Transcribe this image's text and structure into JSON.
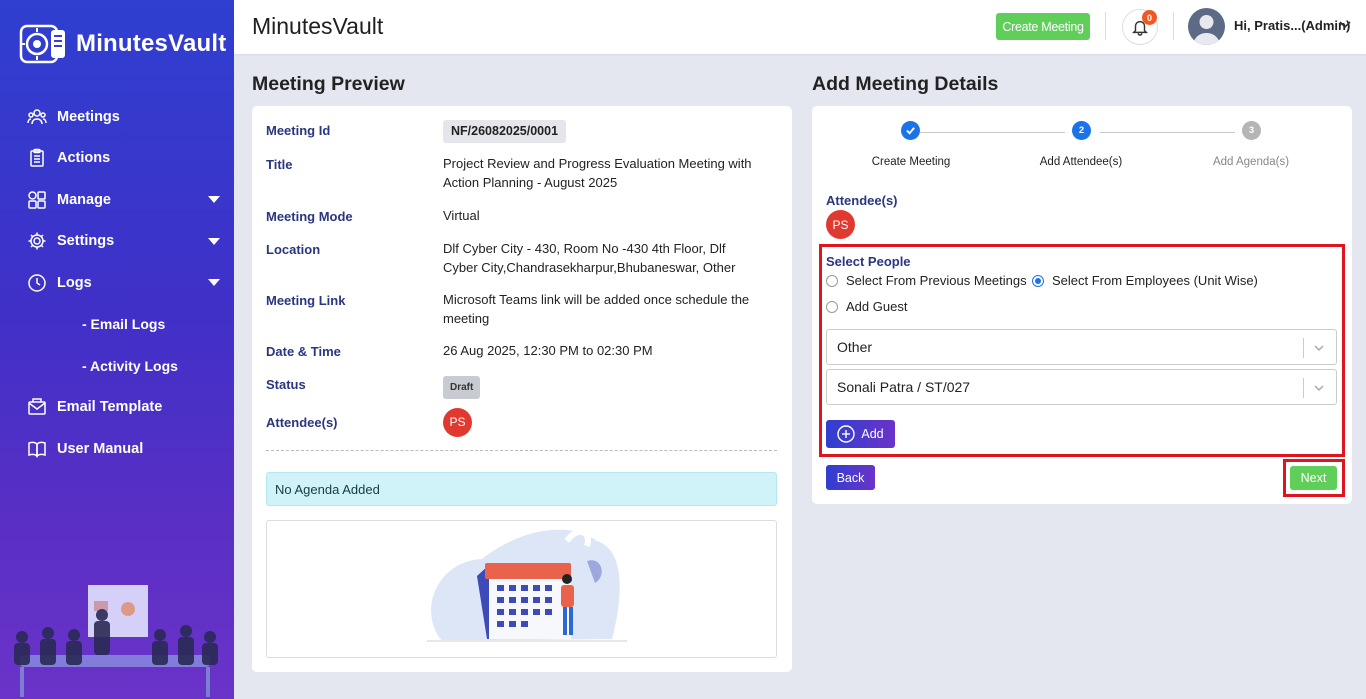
{
  "app": {
    "brand": "MinutesVault",
    "title": "MinutesVault"
  },
  "topbar": {
    "create_label": "Create Meeting",
    "notif_count": "0",
    "user_label": "Hi, Pratis...(Admin)"
  },
  "sidebar": {
    "items": [
      {
        "label": "Meetings",
        "icon": "people-icon"
      },
      {
        "label": "Actions",
        "icon": "clipboard-icon"
      },
      {
        "label": "Manage",
        "icon": "grid-icon"
      },
      {
        "label": "Settings",
        "icon": "gear-icon"
      },
      {
        "label": "Logs",
        "icon": "history-icon"
      },
      {
        "label": "- Email Logs"
      },
      {
        "label": "- Activity Logs"
      },
      {
        "label": "Email Template",
        "icon": "envelope-icon"
      },
      {
        "label": "User Manual",
        "icon": "book-icon"
      }
    ]
  },
  "preview": {
    "heading": "Meeting Preview",
    "meeting_id_label": "Meeting Id",
    "meeting_id": "NF/26082025/0001",
    "title_label": "Title",
    "title": "Project Review and Progress Evaluation Meeting with Action Planning - August 2025",
    "mode_label": "Meeting Mode",
    "mode": "Virtual",
    "location_label": "Location",
    "location": "Dlf Cyber City - 430, Room No -430 4th Floor, Dlf Cyber City,Chandrasekharpur,Bhubaneswar, Other",
    "link_label": "Meeting Link",
    "link": "Microsoft Teams link will be added once schedule the meeting",
    "datetime_label": "Date & Time",
    "datetime": "26 Aug 2025, 12:30 PM to 02:30 PM",
    "status_label": "Status",
    "status": "Draft",
    "attendees_label": "Attendee(s)",
    "attendee_initials": "PS",
    "no_agenda": "No Agenda Added"
  },
  "details": {
    "heading": "Add Meeting Details",
    "steps": [
      {
        "num": "",
        "label": "Create Meeting",
        "state": "done"
      },
      {
        "num": "2",
        "label": "Add Attendee(s)",
        "state": "active"
      },
      {
        "num": "3",
        "label": "Add Agenda(s)",
        "state": "pending"
      }
    ],
    "attendees_label": "Attendee(s)",
    "attendee_initials": "PS",
    "select_people_label": "Select People",
    "radio_prev": "Select From Previous Meetings",
    "radio_emp": "Select From Employees (Unit Wise)",
    "radio_guest": "Add Guest",
    "unit_value": "Other",
    "employee_value": "Sonali Patra / ST/027",
    "add_label": "Add",
    "back_label": "Back",
    "next_label": "Next"
  },
  "colors": {
    "accent": "#3b3bd0",
    "green": "#5fcf5a",
    "highlight": "#e0141c",
    "badge": "#e03a30"
  }
}
